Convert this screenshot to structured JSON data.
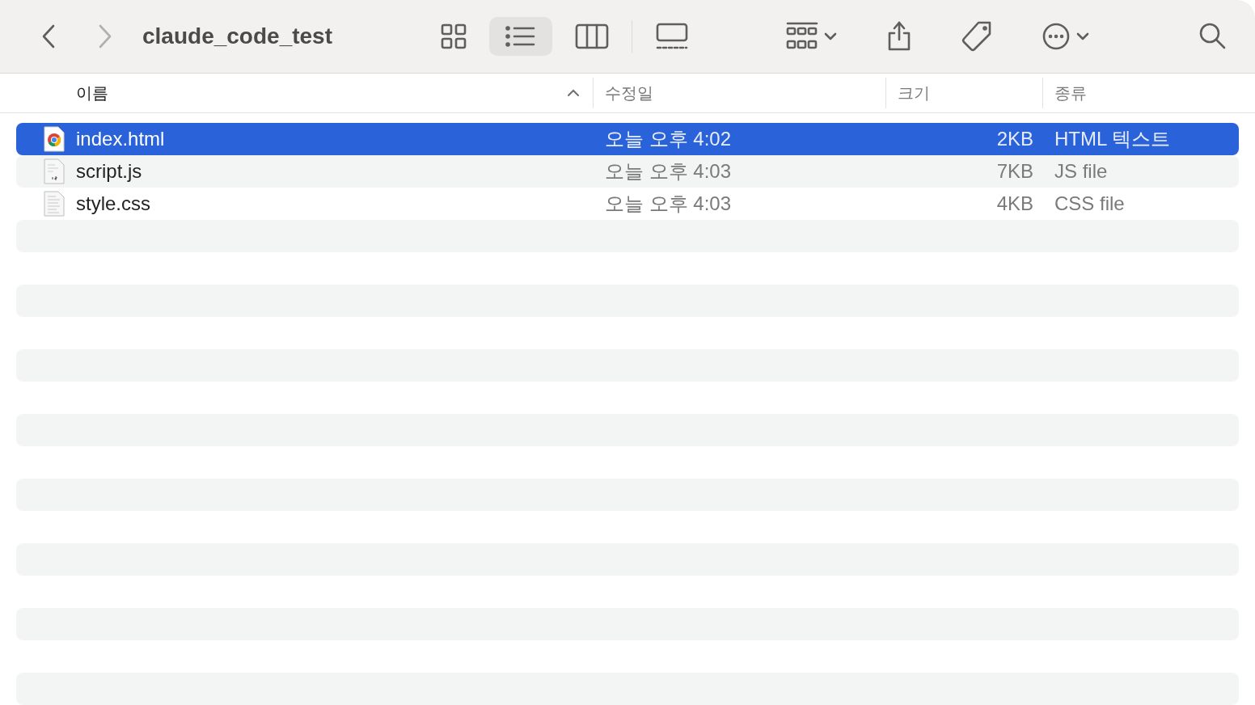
{
  "toolbar": {
    "title": "claude_code_test",
    "back_enabled": true,
    "forward_enabled": false,
    "view_modes": [
      {
        "kind": "icons",
        "selected": false
      },
      {
        "kind": "list",
        "selected": true
      },
      {
        "kind": "columns",
        "selected": false
      },
      {
        "kind": "gallery",
        "selected": false
      }
    ]
  },
  "table": {
    "columns": [
      {
        "label": "이름",
        "sorted": true
      },
      {
        "label": "수정일",
        "sorted": false
      },
      {
        "label": "크기",
        "sorted": false
      },
      {
        "label": "종류",
        "sorted": false
      }
    ],
    "rows": [
      {
        "name": "index.html",
        "kind": "chrome",
        "modified": "오늘 오후 4:02",
        "size": "2KB",
        "type": "HTML 텍스트",
        "selected": true
      },
      {
        "name": "script.js",
        "kind": "js",
        "modified": "오늘 오후 4:03",
        "size": "7KB",
        "type": "JS file",
        "selected": false
      },
      {
        "name": "style.css",
        "kind": "text",
        "modified": "오늘 오후 4:03",
        "size": "4KB",
        "type": "CSS file",
        "selected": false
      }
    ]
  }
}
